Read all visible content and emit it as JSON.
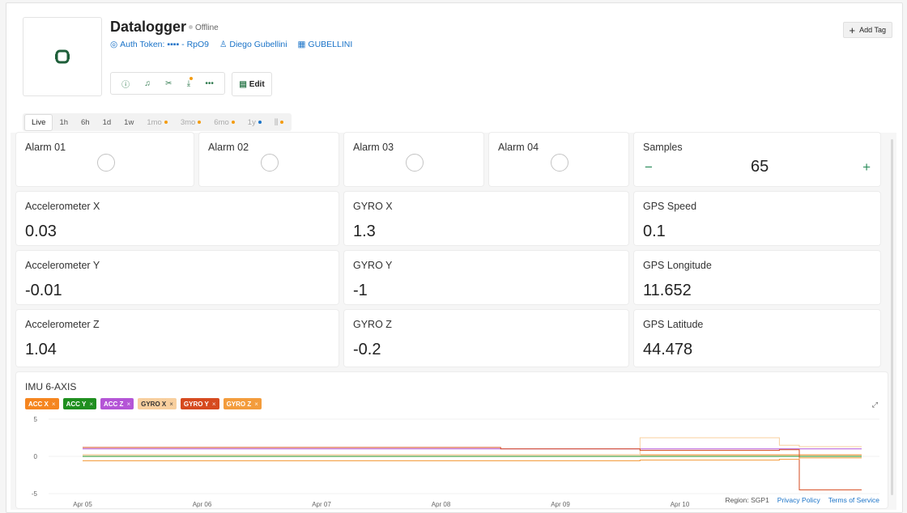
{
  "header": {
    "title": "Datalogger",
    "status": "Offline",
    "auth_token": "Auth Token: ▪▪▪▪ - RpO9",
    "owner": "Diego Gubellini",
    "org": "GUBELLINI",
    "edit_label": "Edit",
    "add_tag_label": "Add Tag"
  },
  "toolbar_icons": [
    "info-icon",
    "bell-icon",
    "tools-icon",
    "download-icon",
    "more-icon"
  ],
  "tabs": [
    {
      "label": "Live",
      "active": true
    },
    {
      "label": "1h"
    },
    {
      "label": "6h"
    },
    {
      "label": "1d"
    },
    {
      "label": "1w"
    },
    {
      "label": "1mo",
      "dot": "#f39c12"
    },
    {
      "label": "3mo",
      "dot": "#f39c12"
    },
    {
      "label": "6mo",
      "dot": "#f39c12"
    },
    {
      "label": "1y",
      "dot": "#1a73c8"
    },
    {
      "label": "⫼",
      "dot": "#f39c12"
    }
  ],
  "alarms": [
    {
      "label": "Alarm 01"
    },
    {
      "label": "Alarm 02"
    },
    {
      "label": "Alarm 03"
    },
    {
      "label": "Alarm 04"
    }
  ],
  "samples": {
    "label": "Samples",
    "value": "65",
    "minus": "−",
    "plus": "+"
  },
  "metrics": [
    {
      "label": "Accelerometer X",
      "value": "0.03"
    },
    {
      "label": "GYRO X",
      "value": "1.3"
    },
    {
      "label": "GPS Speed",
      "value": "0.1"
    },
    {
      "label": "Accelerometer Y",
      "value": "-0.01"
    },
    {
      "label": "GYRO Y",
      "value": "-1"
    },
    {
      "label": "GPS Longitude",
      "value": "11.652"
    },
    {
      "label": "Accelerometer Z",
      "value": "1.04"
    },
    {
      "label": "GYRO Z",
      "value": "-0.2"
    },
    {
      "label": "GPS Latitude",
      "value": "44.478"
    }
  ],
  "chart_title": "IMU 6-AXIS",
  "footer": {
    "region": "Region: SGP1",
    "privacy": "Privacy Policy",
    "terms": "Terms of Service"
  },
  "chart_data": {
    "type": "line",
    "title": "IMU 6-AXIS",
    "ylim": [
      -5,
      5
    ],
    "yticks": [
      "5",
      "0",
      "-5"
    ],
    "xticks": [
      "Apr 05",
      "Apr 06",
      "Apr 07",
      "Apr 08",
      "Apr 09",
      "Apr 10"
    ],
    "x": [
      "Apr 05",
      "Apr 08 12:00",
      "Apr 09 14:00",
      "Apr 09 16:00",
      "Apr 10 20:00",
      "Apr 11 00:00"
    ],
    "series": [
      {
        "name": "ACC X",
        "color": "#f5851f",
        "values": [
          0.2,
          0.2,
          0.2,
          0.2,
          0.2,
          0.2
        ]
      },
      {
        "name": "ACC Y",
        "color": "#1f8f1f",
        "values": [
          0.0,
          0.0,
          0.0,
          0.0,
          0.0,
          0.0
        ]
      },
      {
        "name": "ACC Z",
        "color": "#b455d6",
        "values": [
          1.0,
          1.0,
          1.0,
          1.0,
          1.0,
          1.0
        ]
      },
      {
        "name": "GYRO X",
        "color": "#f8cf9e",
        "values": [
          0.2,
          0.2,
          0.2,
          2.5,
          1.5,
          1.3
        ]
      },
      {
        "name": "GYRO Y",
        "color": "#d64a1f",
        "values": [
          1.2,
          1.0,
          1.0,
          0.8,
          0.9,
          -4.5
        ]
      },
      {
        "name": "GYRO Z",
        "color": "#f39c3c",
        "values": [
          -0.6,
          -0.6,
          -0.6,
          -0.5,
          -0.4,
          -0.2
        ]
      }
    ]
  }
}
